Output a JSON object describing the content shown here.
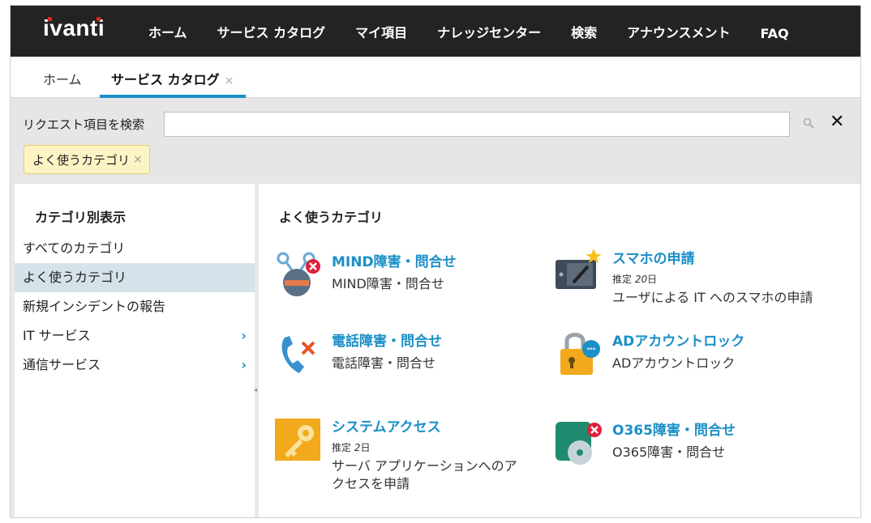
{
  "brand": {
    "logo_text": "ivanti",
    "accent_color": "#1b8fc7",
    "brand_red": "#e2231a"
  },
  "nav": {
    "items": [
      {
        "id": "home",
        "label": "ホーム"
      },
      {
        "id": "service-catalog",
        "label": "サービス カタログ"
      },
      {
        "id": "my-items",
        "label": "マイ項目"
      },
      {
        "id": "knowledge",
        "label": "ナレッジセンター"
      },
      {
        "id": "search",
        "label": "検索"
      },
      {
        "id": "announcements",
        "label": "アナウンスメント"
      },
      {
        "id": "faq",
        "label": "FAQ"
      }
    ]
  },
  "tabs": {
    "home_label": "ホーム",
    "catalog_label": "サービス カタログ",
    "close_glyph": "×"
  },
  "search": {
    "label": "リクエスト項目を検索",
    "value": "",
    "placeholder": "",
    "search_icon": "magnifier-icon",
    "clear_glyph": "✕",
    "filter_chip": "よく使うカテゴリ",
    "chip_close_glyph": "×"
  },
  "sidebar": {
    "title": "カテゴリ別表示",
    "items": [
      {
        "label": "すべてのカテゴリ",
        "active": false,
        "has_children": false
      },
      {
        "label": "よく使うカテゴリ",
        "active": true,
        "has_children": false
      },
      {
        "label": "新規インシデントの報告",
        "active": false,
        "has_children": false
      },
      {
        "label": "IT サービス",
        "active": false,
        "has_children": true
      },
      {
        "label": "通信サービス",
        "active": false,
        "has_children": true
      }
    ],
    "chevron_glyph": "›"
  },
  "main": {
    "title": "よく使うカテゴリ",
    "items": [
      {
        "title": "MIND障害・問合せ",
        "estimate_prefix": "",
        "estimate_value": "",
        "estimate_unit": "",
        "desc": "MIND障害・問合せ",
        "icon": "network-error-icon"
      },
      {
        "title": "スマホの申請",
        "estimate_prefix": "推定",
        "estimate_value": "20",
        "estimate_unit": "日",
        "desc": "ユーザによる IT へのスマホの申請",
        "icon": "tablet-new-icon"
      },
      {
        "title": "電話障害・問合せ",
        "estimate_prefix": "",
        "estimate_value": "",
        "estimate_unit": "",
        "desc": "電話障害・問合せ",
        "icon": "phone-error-icon"
      },
      {
        "title": "ADアカウントロック",
        "estimate_prefix": "",
        "estimate_value": "",
        "estimate_unit": "",
        "desc": "ADアカウントロック",
        "icon": "account-lock-icon"
      },
      {
        "title": "システムアクセス",
        "estimate_prefix": "推定",
        "estimate_value": "2",
        "estimate_unit": "日",
        "desc": "サーバ アプリケーションへのアクセスを申請",
        "icon": "key-icon"
      },
      {
        "title": "O365障害・問合せ",
        "estimate_prefix": "",
        "estimate_value": "",
        "estimate_unit": "",
        "desc": "O365障害・問合せ",
        "icon": "disk-error-icon"
      }
    ]
  }
}
